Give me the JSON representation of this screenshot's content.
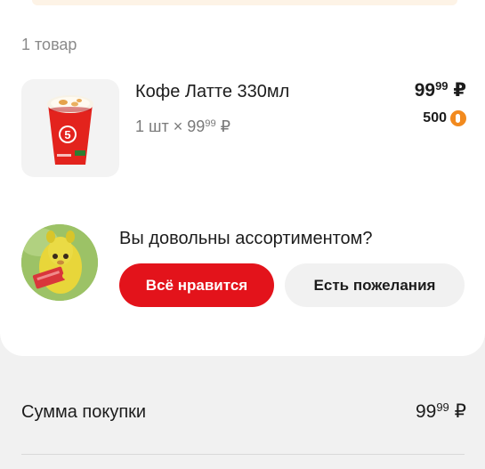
{
  "order": {
    "item_count_label": "1 товар"
  },
  "product": {
    "name": "Кофе Латте 330мл",
    "qty_prefix": "1 шт × 99",
    "qty_kopecks": "99",
    "qty_currency": " ₽",
    "price_rub": "99",
    "price_kop": "99",
    "price_currency": " ₽",
    "bonus_points": "500",
    "thumbnail_icon": "coffee-cup-image",
    "bonus_icon": "bonus-coin-icon"
  },
  "feedback": {
    "question": "Вы довольны ассортиментом?",
    "like_label": "Всё нравится",
    "wish_label": "Есть пожелания",
    "avatar_icon": "pear-mascot-avatar"
  },
  "summary": {
    "label": "Сумма покупки",
    "total_rub": "99",
    "total_kop": "99",
    "currency": " ₽"
  },
  "colors": {
    "accent_red": "#e3131b",
    "bonus_orange": "#f28a1e",
    "page_bg": "#f1f1f1",
    "card_bg": "#ffffff"
  }
}
